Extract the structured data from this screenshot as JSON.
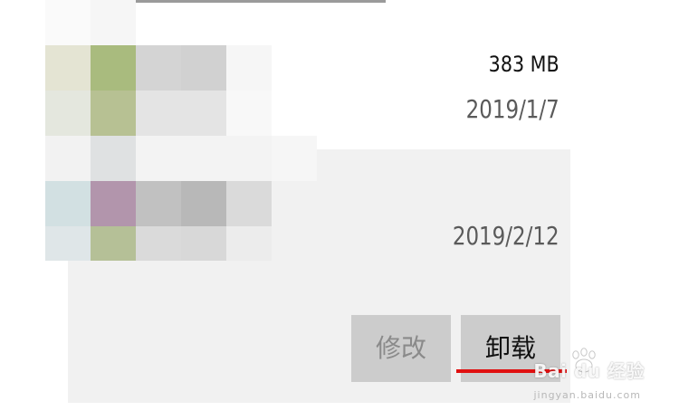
{
  "app_list": {
    "entry_1": {
      "size": "383 MB",
      "date": "2019/1/7"
    },
    "entry_2": {
      "date": "2019/2/12",
      "actions": {
        "modify_label": "修改",
        "uninstall_label": "卸载"
      }
    }
  },
  "icons": {
    "app_icon_mosaic": "pixelated-app-icon",
    "watermark_logo": "baidu-paw-icon"
  },
  "colors": {
    "selected_background": "#f1f1f1",
    "button_background": "#cccccc",
    "highlight_underline": "#e01010"
  },
  "watermark": {
    "brand": "Bai du 经验",
    "url": "jingyan.baidu.com"
  }
}
